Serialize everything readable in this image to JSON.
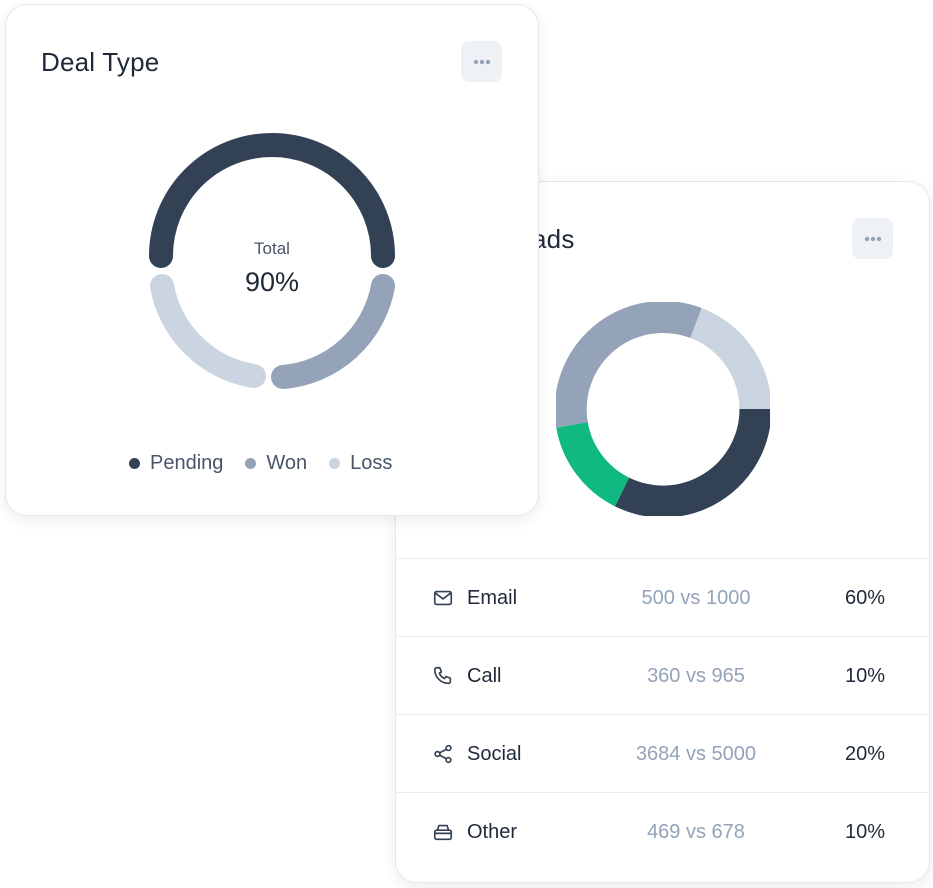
{
  "deal_type": {
    "title": "Deal Type",
    "center_label": "Total",
    "center_value": "90%",
    "legend": [
      {
        "label": "Pending",
        "color": "#334155"
      },
      {
        "label": "Won",
        "color": "#94a3b8"
      },
      {
        "label": "Loss",
        "color": "#cbd5e1"
      }
    ],
    "more_icon": "more-horizontal-icon"
  },
  "leads": {
    "title": "ads",
    "more_icon": "more-horizontal-icon",
    "rows": [
      {
        "icon": "mail-icon",
        "label": "Email",
        "compare": "500 vs 1000",
        "percent": "60%"
      },
      {
        "icon": "phone-icon",
        "label": "Call",
        "compare": "360 vs 965",
        "percent": "10%"
      },
      {
        "icon": "share-icon",
        "label": "Social",
        "compare": "3684 vs 5000",
        "percent": "20%"
      },
      {
        "icon": "inbox-icon",
        "label": "Other",
        "compare": "469 vs 678",
        "percent": "10%"
      }
    ]
  },
  "colors": {
    "pending": "#334155",
    "won": "#94a3b8",
    "loss": "#cbd5e1",
    "green": "#10b981",
    "text_dark": "#1f2937",
    "text_muted": "#94a3b8"
  }
}
